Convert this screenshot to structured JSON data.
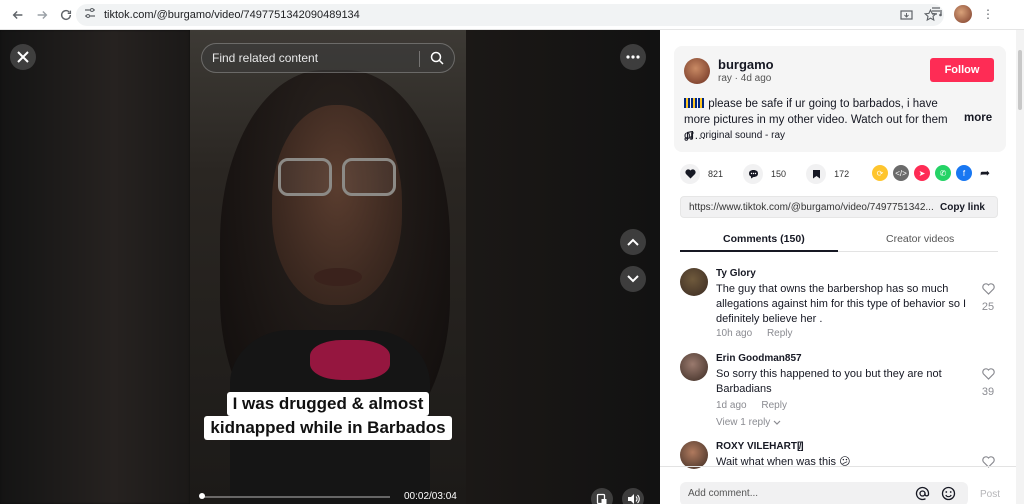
{
  "browser": {
    "url": "tiktok.com/@burgamo/video/7497751342090489134"
  },
  "player": {
    "search_placeholder": "Find related content",
    "caption_line1": "I was drugged & almost",
    "caption_line2": "kidnapped while in Barbados",
    "time": "00:02/03:04",
    "progress_fraction": 0.011
  },
  "post": {
    "author": "burgamo",
    "sub": "ray · 4d ago",
    "follow_label": "Follow",
    "description": "please be safe if ur going to barbados, i have more pictures in my other video. Watch out for them or…",
    "more_label": "more",
    "sound": "original sound - ray",
    "likes": "821",
    "comments": "150",
    "saves": "172",
    "share_link": "https://www.tiktok.com/@burgamo/video/7497751342...",
    "copy_label": "Copy link"
  },
  "tabs": {
    "comments": "Comments (150)",
    "creator": "Creator videos"
  },
  "comments": [
    {
      "user": "Ty Glory",
      "text": "The guy that owns the barbershop has so much allegations against him for this type of behavior so I definitely believe her .",
      "time": "10h ago",
      "reply": "Reply",
      "likes": "25",
      "avatar_color": "#6f5a3c"
    },
    {
      "user": "Erin Goodman857",
      "text": "So sorry this happened to you but they are not Barbadians",
      "time": "1d ago",
      "reply": "Reply",
      "likes": "39",
      "view_replies": "View 1 reply",
      "avatar_color": "#9a7a6e"
    },
    {
      "user": "ROXY VILEHART[̸]",
      "text": "Wait what when was this",
      "emoji": "😕",
      "avatar_color": "#b07a5e"
    }
  ],
  "composer": {
    "placeholder": "Add comment...",
    "post_label": "Post"
  },
  "colors": {
    "accent": "#fe2c55",
    "dark": "#161823"
  }
}
